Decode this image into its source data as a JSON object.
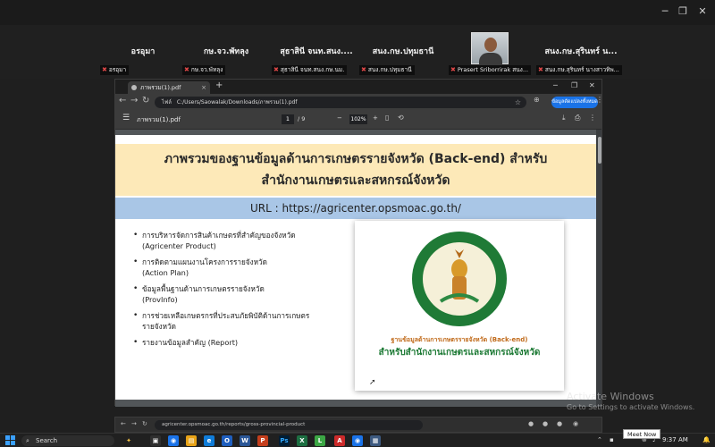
{
  "meeting": {
    "participants": [
      {
        "name": "อรอุมา",
        "label": "อรอุมา"
      },
      {
        "name": "กษ.จว.พัทลุง",
        "label": "กษ.จว.พัทลุง"
      },
      {
        "name": "สุธาสินี จนท.สนง....",
        "label": "สุธาสินี จนท.สนง.กษ.นม."
      },
      {
        "name": "สนง.กษ.ปทุมธานี",
        "label": "สนง.กษ.ปทุมธานี"
      },
      {
        "name": "",
        "label": "Prasert Sriborrirak สนง..."
      },
      {
        "name": "สนง.กษ.สุรินทร์ น...",
        "label": "สนง.กษ.สุรินทร์ นางสาวทิพ..."
      }
    ],
    "window_controls": {
      "minimize": "─",
      "restore": "❐",
      "close": "✕"
    }
  },
  "browser": {
    "tab_title": "ภาพรวม(1).pdf",
    "tab_close": "×",
    "new_tab": "+",
    "info_label": "ไฟล์",
    "address": "C:/Users/Saowalak/Downloads/ภาพรวม(1).pdf",
    "profile_label": "ข้อมูลดัดแปลงทั้งหมด",
    "nav": {
      "back": "←",
      "forward": "→",
      "reload": "↻"
    },
    "star": "☆",
    "menu_dots": "⋮",
    "window_controls": {
      "minimize": "─",
      "restore": "❐",
      "close": "✕"
    }
  },
  "pdf_toolbar": {
    "menu_icon": "☰",
    "file_name": "ภาพรวม(1).pdf",
    "current_page": "1",
    "total_pages": "/ 9",
    "zoom_out": "−",
    "zoom_value": "102%",
    "zoom_in": "+",
    "download": "⤓",
    "print": "⎙",
    "more": "⋮"
  },
  "slide": {
    "title_line1": "ภาพรวมของฐานข้อมูลด้านการเกษตรรายจังหวัด (Back-end) สำหรับ",
    "title_line2": "สำนักงานเกษตรและสหกรณ์จังหวัด",
    "url_line": "URL : https://agricenter.opsmoac.go.th/",
    "bullets": [
      {
        "th": "การบริหารจัดการสินค้าเกษตรที่สำคัญของจังหวัด",
        "en": "(Agricenter Product)"
      },
      {
        "th": "การติดตามแผนงานโครงการรายจังหวัด",
        "en": "(Action Plan)"
      },
      {
        "th": "ข้อมูลพื้นฐานด้านการเกษตรรายจังหวัด",
        "en": "(ProvInfo)"
      },
      {
        "th": "การช่วยเหลือเกษตรกรที่ประสบภัยพิบัติด้านการเกษตร",
        "en": "รายจังหวัด"
      },
      {
        "th": "รายงานข้อมูลสำคัญ (Report)",
        "en": ""
      }
    ],
    "card_line1": "ฐานข้อมูลด้านการเกษตรรายจังหวัด (Back-end)",
    "card_line2": "สำหรับสำนักงานเกษตรและสหกรณ์จังหวัด"
  },
  "second_window": {
    "address": "agricenter.opsmoac.go.th/reports/gross-provincial-product"
  },
  "watermark": {
    "title": "Activate Windows",
    "subtitle": "Go to Settings to activate Windows."
  },
  "taskbar": {
    "search_label": "Search",
    "meet_now": "Meet Now",
    "time": "9:37 AM",
    "apps": [
      "Ps",
      "Ex",
      "Ed",
      "Ch",
      "Wd",
      "Ou",
      "Ph",
      "Gr",
      "Fx",
      "Cr",
      "Zm"
    ]
  }
}
